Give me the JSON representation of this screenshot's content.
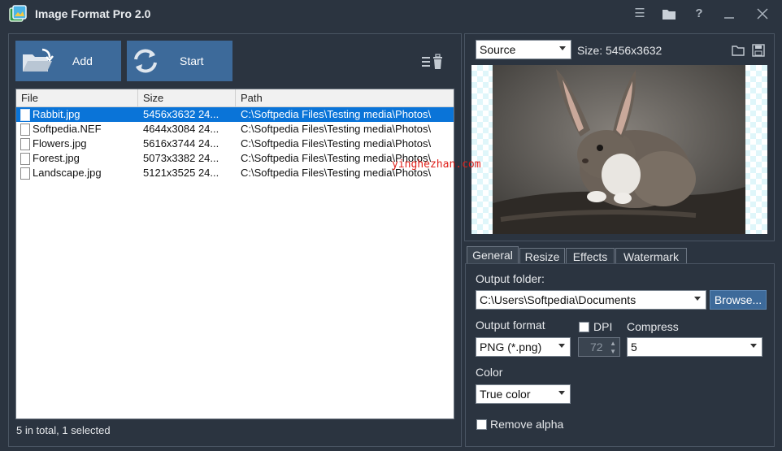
{
  "window": {
    "title": "Image Format Pro 2.0",
    "icons": [
      "app-logo-icon",
      "menu-icon",
      "folder-icon",
      "help-icon",
      "minimize-icon",
      "close-icon"
    ]
  },
  "toolbar": {
    "add_label": "Add",
    "start_label": "Start"
  },
  "file_list": {
    "columns": [
      "File",
      "Size",
      "Path"
    ],
    "rows": [
      {
        "name": "Rabbit.jpg",
        "size": "5456x3632  24...",
        "path": "C:\\Softpedia Files\\Testing media\\Photos\\",
        "selected": true
      },
      {
        "name": "Softpedia.NEF",
        "size": "4644x3084  24...",
        "path": "C:\\Softpedia Files\\Testing media\\Photos\\",
        "selected": false
      },
      {
        "name": "Flowers.jpg",
        "size": "5616x3744  24...",
        "path": "C:\\Softpedia Files\\Testing media\\Photos\\",
        "selected": false
      },
      {
        "name": "Forest.jpg",
        "size": "5073x3382  24...",
        "path": "C:\\Softpedia Files\\Testing media\\Photos\\",
        "selected": false
      },
      {
        "name": "Landscape.jpg",
        "size": "5121x3525  24...",
        "path": "C:\\Softpedia Files\\Testing media\\Photos\\",
        "selected": false
      }
    ]
  },
  "status": "5 in total, 1 selected",
  "preview": {
    "source_select": "Source",
    "size_label": "Size: 5456x3632",
    "watermark_text": "yinghezhan.com"
  },
  "tabs": [
    "General",
    "Resize",
    "Effects",
    "Watermark"
  ],
  "general": {
    "output_folder_label": "Output folder:",
    "output_folder_value": "C:\\Users\\Softpedia\\Documents",
    "browse_label": "Browse...",
    "output_format_label": "Output format",
    "output_format_value": "PNG (*.png)",
    "dpi_label": "DPI",
    "dpi_value": "72",
    "compress_label": "Compress",
    "compress_value": "5",
    "color_label": "Color",
    "color_value": "True color",
    "remove_alpha_label": "Remove alpha"
  },
  "colors": {
    "background": "#2b3440",
    "accent": "#3d6a9a",
    "selection": "#0a74d8",
    "watermark": "#e0201a"
  }
}
